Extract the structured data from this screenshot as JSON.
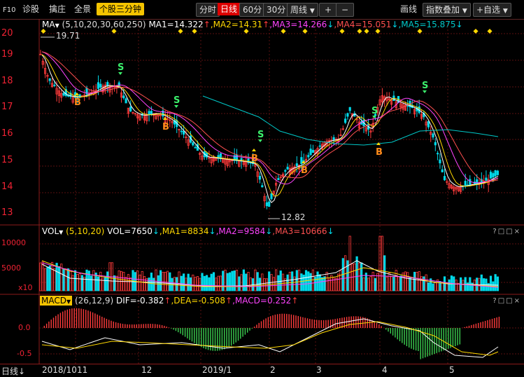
{
  "toolbar": {
    "f10": "F10",
    "diagnose": "诊股",
    "pick": "擒庄",
    "overview": "全景",
    "mode": "个股三分钟",
    "periods": [
      "分时",
      "日线",
      "60分",
      "30分",
      "周线"
    ],
    "active_period": "日线",
    "plus": "+",
    "minus": "−",
    "draw": "画线",
    "overlay": "指数叠加",
    "add_watch": "+自选"
  },
  "main_legend": {
    "name": "MA",
    "params": "(5,10,20,30,60,250)",
    "ma1": "MA1=14.322",
    "ma2": ",MA2=14.31",
    "ma3": ",MA3=14.266",
    "ma4": ",MA4=15.051",
    "ma5": ",MA5=15.875"
  },
  "main_axis": [
    "20",
    "19",
    "18",
    "17",
    "16",
    "15",
    "14",
    "13"
  ],
  "annotations": {
    "high": "19.71",
    "low": "12.82"
  },
  "vol_legend": {
    "name": "VOL",
    "params": "(5,10,20)",
    "vol": "VOL=7650",
    "ma1": ",MA1=8834",
    "ma2": ",MA2=9584",
    "ma3": ",MA3=10666"
  },
  "vol_axis": [
    "10000",
    "5000",
    "x10"
  ],
  "macd_legend": {
    "name": "MACD",
    "params": "(26,12,9)",
    "dif": "DIF=-0.382",
    "dea": ",DEA=-0.508",
    "macd": ",MACD=0.252"
  },
  "macd_axis": [
    "0.0",
    "-0.5"
  ],
  "date_axis": {
    "mode": "日线",
    "labels": [
      "2018/10",
      "11",
      "12",
      "2019/1",
      "2",
      "3",
      "4",
      "5"
    ]
  },
  "signals": {
    "buy": "B",
    "sell": "S"
  },
  "colors": {
    "up": "#ff3b3b",
    "down": "#00d8e8",
    "ma1": "#ffffff",
    "ma2": "#ffd800",
    "ma3": "#ff44ff",
    "ma4": "#ff5050",
    "ma5": "#00c8c8",
    "grid": "#5a1010"
  }
}
